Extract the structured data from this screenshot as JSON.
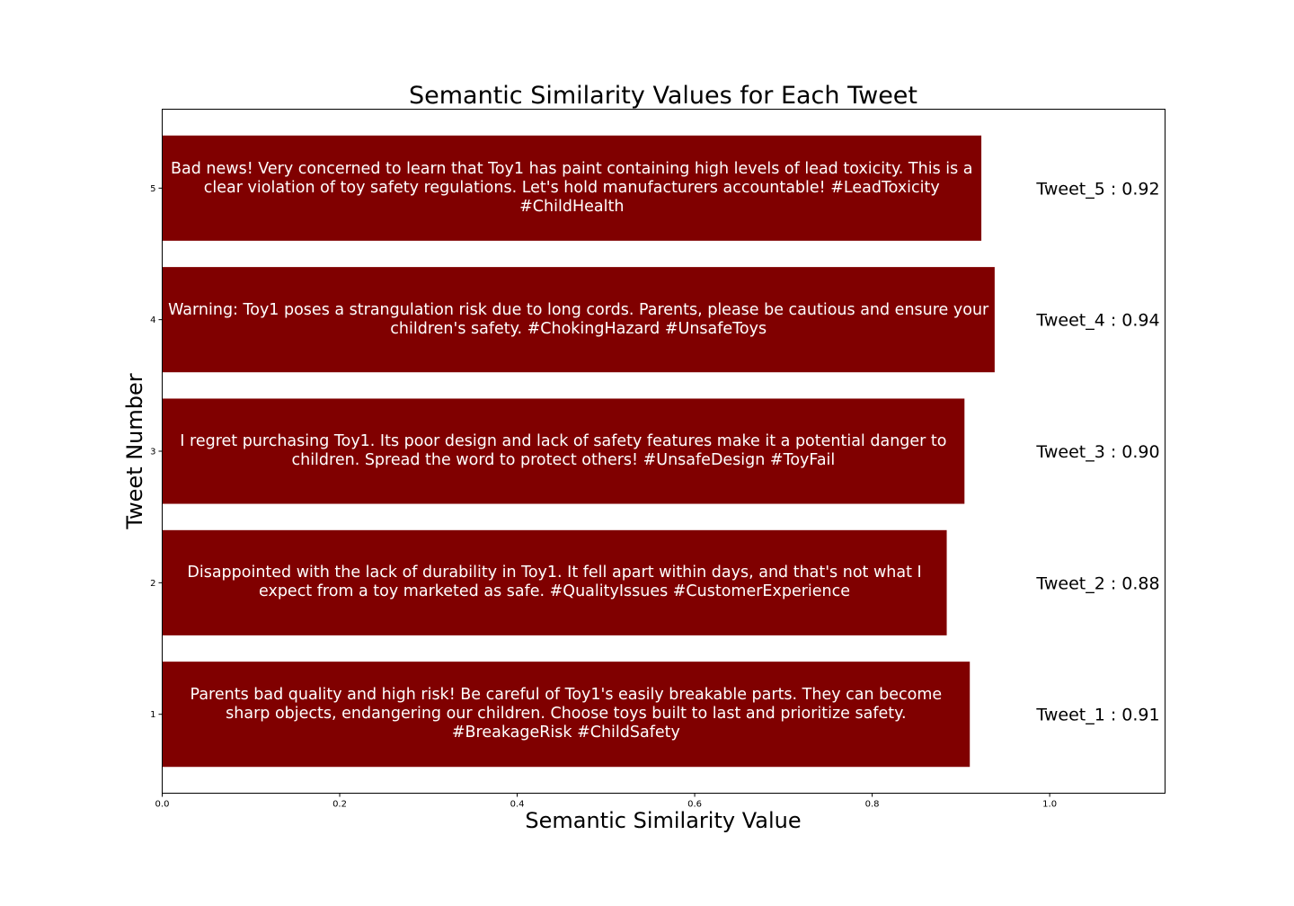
{
  "chart_data": {
    "type": "bar",
    "orientation": "horizontal",
    "title": "Semantic Similarity Values for Each Tweet",
    "xlabel": "Semantic Similarity Value",
    "ylabel": "Tweet Number",
    "xlim": [
      0,
      1.13
    ],
    "x_ticks": [
      "0.0",
      "0.2",
      "0.4",
      "0.6",
      "0.8",
      "1.0"
    ],
    "bar_color": "#800000",
    "grid": false,
    "bars": [
      {
        "tweet_number": 1,
        "y_tick": "1",
        "value": 0.91,
        "value_label": "Tweet_1 : 0.91",
        "text": "Parents bad quality and high risk! Be careful of Toy1's easily breakable parts. They can become sharp objects, endangering our children. Choose toys built to last and prioritize safety. #BreakageRisk #ChildSafety"
      },
      {
        "tweet_number": 2,
        "y_tick": "2",
        "value": 0.884,
        "value_label": "Tweet_2 : 0.88",
        "text": "Disappointed with the lack of durability in Toy1. It fell apart within days, and that's not what I expect from a toy marketed as safe. #QualityIssues #CustomerExperience"
      },
      {
        "tweet_number": 3,
        "y_tick": "3",
        "value": 0.904,
        "value_label": "Tweet_3 : 0.90",
        "text": "I regret purchasing Toy1. Its poor design and lack of safety features make it a potential danger to children. Spread the word to protect others! #UnsafeDesign #ToyFail"
      },
      {
        "tweet_number": 4,
        "y_tick": "4",
        "value": 0.938,
        "value_label": "Tweet_4 : 0.94",
        "text": "Warning: Toy1 poses a strangulation risk due to long cords. Parents, please be cautious and ensure your children's safety. #ChokingHazard #UnsafeToys"
      },
      {
        "tweet_number": 5,
        "y_tick": "5",
        "value": 0.923,
        "value_label": "Tweet_5 : 0.92",
        "text": "Bad news! Very concerned to learn that Toy1 has paint containing high levels of lead toxicity. This is a clear violation of toy safety regulations. Let's hold manufacturers accountable! #LeadToxicity #ChildHealth"
      }
    ]
  }
}
